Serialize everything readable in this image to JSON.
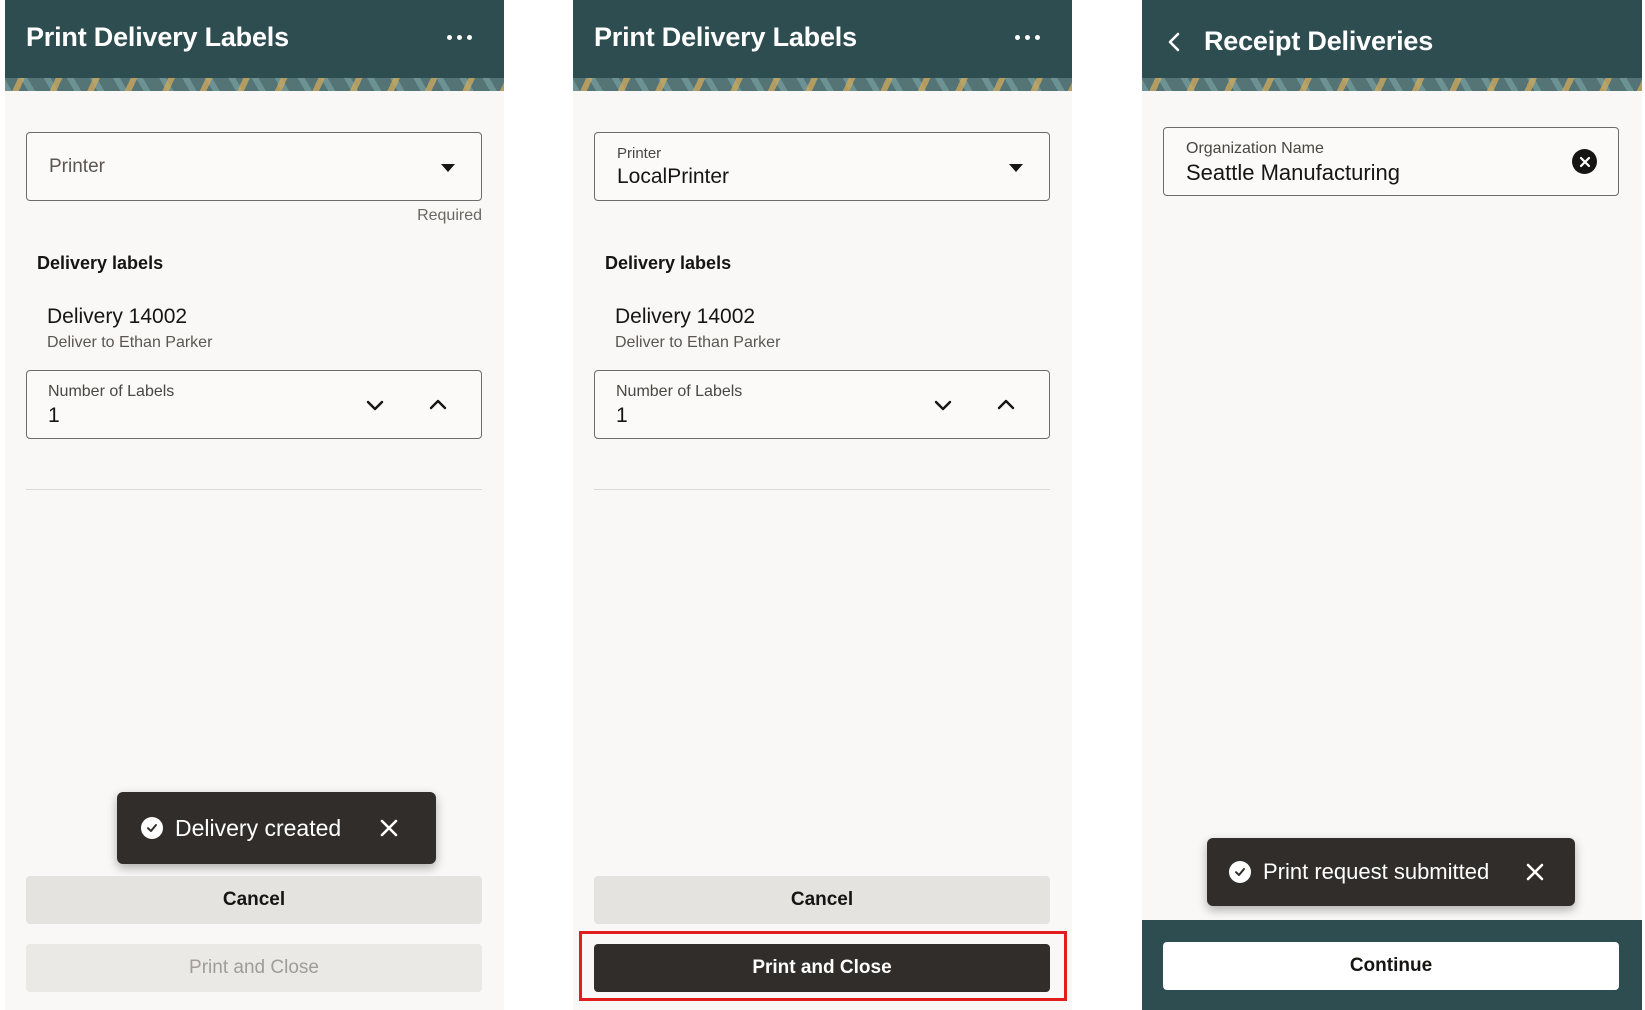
{
  "screen1": {
    "header": {
      "title": "Print Delivery Labels",
      "more_icon": "more-horizontal-icon"
    },
    "printer": {
      "placeholder": "Printer",
      "required_text": "Required"
    },
    "section_title": "Delivery labels",
    "delivery": {
      "name": "Delivery 14002",
      "subtitle": "Deliver to Ethan Parker"
    },
    "labels_stepper": {
      "label": "Number of Labels",
      "value": "1"
    },
    "toast": {
      "message": "Delivery created"
    },
    "cancel_label": "Cancel",
    "print_label": "Print and Close"
  },
  "screen2": {
    "header": {
      "title": "Print Delivery Labels",
      "more_icon": "more-horizontal-icon"
    },
    "printer": {
      "label": "Printer",
      "value": "LocalPrinter"
    },
    "section_title": "Delivery labels",
    "delivery": {
      "name": "Delivery 14002",
      "subtitle": "Deliver to Ethan Parker"
    },
    "labels_stepper": {
      "label": "Number of Labels",
      "value": "1"
    },
    "cancel_label": "Cancel",
    "print_label": "Print and Close"
  },
  "screen3": {
    "header": {
      "title": "Receipt Deliveries",
      "back_icon": "chevron-left-icon"
    },
    "organization": {
      "label": "Organization Name",
      "value": "Seattle Manufacturing"
    },
    "toast": {
      "message": "Print request submitted"
    },
    "continue_label": "Continue"
  },
  "colors": {
    "header_bg": "#2e4d51",
    "toast_bg": "#312d2a",
    "primary_button_bg": "#312d2a",
    "highlight_border": "#e11d1d",
    "page_bg": "#f9f8f6"
  }
}
